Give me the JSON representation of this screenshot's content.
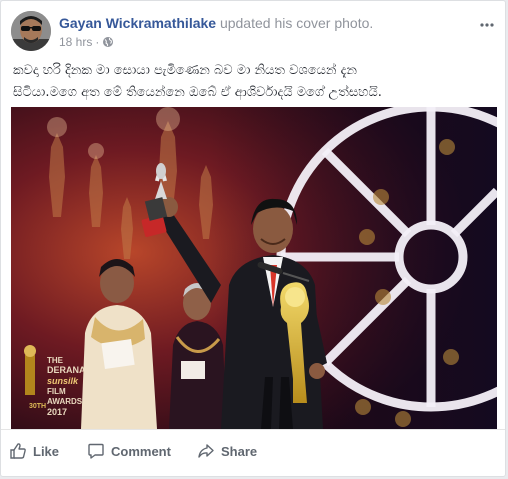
{
  "post": {
    "author": "Gayan Wickramathilake",
    "action_text": " updated his cover photo.",
    "time": "18 hrs",
    "separator": "·",
    "privacy_icon": "globe-icon",
    "more_icon": "more-options-icon",
    "text_line_1": "කවදා හරි දිනක මා සොයා පැමිණෙන බව මා නියත වශයෙන් දැන",
    "text_line_2": "සිටියා.මගෙ අත මේ තියෙන්නෙ ඔබේ ඒ ආශිර්වාදයි මගේ උත්සහයි."
  },
  "photo": {
    "logo_line_1": "THE",
    "logo_line_2": "DERANA",
    "logo_line_3": "sunsilk",
    "logo_line_4": "FILM",
    "logo_line_5": "AWARDS",
    "logo_line_6": "2017",
    "logo_side_1": "30TH"
  },
  "actions": {
    "like": "Like",
    "comment": "Comment",
    "share": "Share"
  },
  "colors": {
    "link": "#365899",
    "muted": "#90949c",
    "action": "#606770",
    "stage": "#200a12"
  }
}
